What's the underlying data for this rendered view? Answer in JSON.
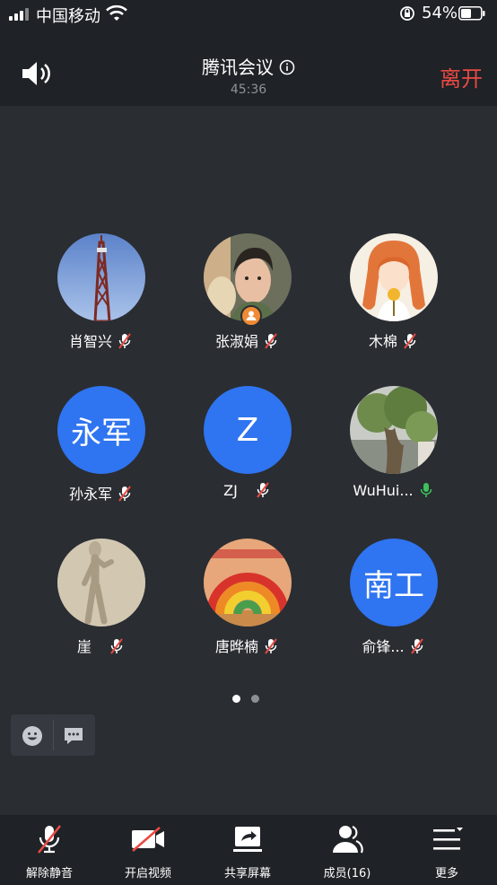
{
  "status_bar": {
    "carrier": "中国移动",
    "battery_percent": "54%",
    "battery_level": 0.54
  },
  "header": {
    "title": "腾讯会议",
    "timer": "45:36",
    "leave_label": "离开"
  },
  "participants": [
    {
      "name": "肖智兴",
      "avatar": "photo-tower",
      "mic": "muted"
    },
    {
      "name": "张淑娟",
      "avatar": "photo-person",
      "mic": "muted",
      "host": true
    },
    {
      "name": "木棉",
      "avatar": "photo-anime-girl",
      "mic": "muted"
    },
    {
      "name": "孙永军",
      "avatar_text": "永军",
      "avatar": "initials",
      "mic": "muted"
    },
    {
      "name": "ZJ",
      "avatar_text": "Z",
      "avatar": "initials",
      "mic": "muted"
    },
    {
      "name": "WuHui...",
      "avatar": "photo-tree",
      "mic": "active"
    },
    {
      "name": "崖",
      "avatar": "photo-figure",
      "mic": "muted"
    },
    {
      "name": "唐晔楠",
      "avatar": "photo-rainbow-toy",
      "mic": "muted"
    },
    {
      "name": "俞锋...",
      "avatar_text": "南工",
      "avatar": "initials",
      "mic": "muted"
    }
  ],
  "pager": {
    "current": 1,
    "total": 2
  },
  "bottom_bar": {
    "unmute_label": "解除静音",
    "video_label": "开启视频",
    "share_label": "共享屏幕",
    "members_label": "成员(16)",
    "more_label": "更多"
  },
  "colors": {
    "accent_blue": "#2f74f0",
    "leave_red": "#e84a43",
    "mic_active": "#3ec15a",
    "host_badge": "#f08a35"
  }
}
